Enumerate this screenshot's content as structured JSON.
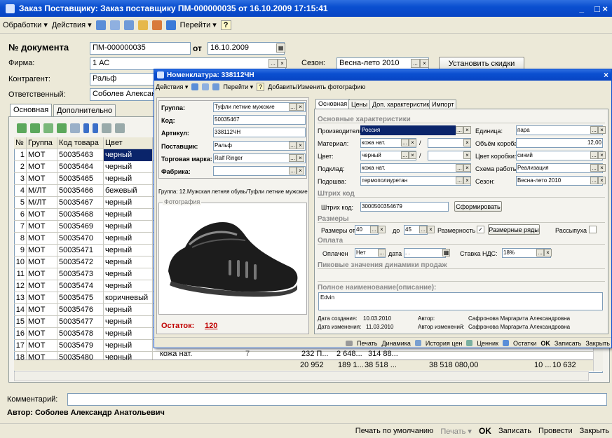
{
  "window": {
    "title": "Заказ Поставщику: Заказ поставщику ПМ-000000035 от 16.10.2009 17:15:41",
    "min": "_",
    "close": "□ ×"
  },
  "toolbar": {
    "processing": "Обработки ▾",
    "actions": "Действия ▾",
    "goto": "Перейти ▾",
    "help": "?"
  },
  "header": {
    "doc_label": "№ документа",
    "doc_value": "ПМ-000000035",
    "from_label": "от",
    "date_value": "16.10.2009",
    "firm_label": "Фирма:",
    "firm_value": "1 АС",
    "season_label": "Сезон:",
    "season_value": "Весна-лето 2010",
    "set_discounts": "Установить скидки",
    "contractor_label": "Контрагент:",
    "contractor_value": "Ральф",
    "responsible_label": "Ответственный:",
    "responsible_value": "Соболев Александ"
  },
  "tabs": {
    "main": "Основная",
    "extra": "Дополнительно"
  },
  "grid": {
    "headers": [
      "№",
      "Группа",
      "Код товара",
      "Цвет"
    ],
    "rows": [
      [
        "1",
        "МОТ",
        "50035463",
        "черный"
      ],
      [
        "2",
        "МОТ",
        "50035464",
        "черный"
      ],
      [
        "3",
        "МОТ",
        "50035465",
        "черный"
      ],
      [
        "4",
        "М/ЛТ",
        "50035466",
        "бежевый"
      ],
      [
        "5",
        "М/ЛТ",
        "50035467",
        "черный"
      ],
      [
        "6",
        "МОТ",
        "50035468",
        "черный"
      ],
      [
        "7",
        "МОТ",
        "50035469",
        "черный"
      ],
      [
        "8",
        "МОТ",
        "50035470",
        "черный"
      ],
      [
        "9",
        "МОТ",
        "50035471",
        "черный"
      ],
      [
        "10",
        "МОТ",
        "50035472",
        "черный"
      ],
      [
        "11",
        "МОТ",
        "50035473",
        "черный"
      ],
      [
        "12",
        "МОТ",
        "50035474",
        "черный"
      ],
      [
        "13",
        "МОТ",
        "50035475",
        "коричневый"
      ],
      [
        "14",
        "МОТ",
        "50035476",
        "черный"
      ],
      [
        "15",
        "МОТ",
        "50035477",
        "черный"
      ],
      [
        "16",
        "МОТ",
        "50035478",
        "черный"
      ],
      [
        "17",
        "МОТ",
        "50035479",
        "черный"
      ],
      [
        "18",
        "МОТ",
        "50035480",
        "черный"
      ]
    ],
    "row18_partial": [
      "кожа нат.",
      "7",
      "232 П...",
      "2 648...",
      "314 88..."
    ],
    "totals": [
      "20 952",
      "189 1...",
      "38 518 ...",
      "38 518 080,00",
      "10 ...",
      "10 632"
    ]
  },
  "footer": {
    "comment_label": "Комментарий:",
    "author": "Автор: Соболев Александр Анатольевич",
    "print_default": "Печать по умолчанию",
    "print": "Печать ▾",
    "ok": "OK",
    "save": "Записать",
    "post": "Провести",
    "close": "Закрыть"
  },
  "dialog": {
    "title": "Номенклатура: 338112ЧН",
    "toolbar": {
      "actions": "Действия ▾",
      "goto": "Перейти ▾",
      "help": "?",
      "add_photo": "Добавить/Изменить фотографию"
    },
    "left": {
      "group_label": "Группа:",
      "group_value": "Туфли летние мужские",
      "code_label": "Код:",
      "code_value": "50035467",
      "art_label": "Артикул:",
      "art_value": "338112ЧН",
      "supplier_label": "Поставщик:",
      "supplier_value": "Ральф",
      "brand_label": "Торговая марка:",
      "brand_value": "Ralf Ringer",
      "factory_label": "Фабрика:",
      "factory_value": "",
      "group_path": "Группа: 12.Мужская летняя обувь/Туфли летние мужские",
      "photo_label": "Фотография",
      "stock_label": "Остаток:",
      "stock_value": "120"
    },
    "tabs": [
      "Основная",
      "Цены",
      "Доп. характеристики",
      "Импорт"
    ],
    "main": {
      "sect_chars": "Основные характеристики",
      "maker_label": "Производитель:",
      "maker_value": "Россия",
      "unit_label": "Единица:",
      "unit_value": "пара",
      "material_label": "Материал:",
      "material_value": "кожа нат.",
      "boxvol_label": "Объём короба:",
      "boxvol_value": "12,00",
      "color_label": "Цвет:",
      "color_value": "черный",
      "boxcolor_label": "Цвет коробки:",
      "boxcolor_value": "синий",
      "lining_label": "Подклад:",
      "lining_value": "кожа нат.",
      "scheme_label": "Схема работы:",
      "scheme_value": "Реализация",
      "sole_label": "Подошва:",
      "sole_value": "термополиуретан",
      "season_label": "Сезон:",
      "season_value": "Весна-лето 2010",
      "sect_barcode": "Штрих код",
      "barcode_label": "Штрих код:",
      "barcode_value": "3000500354679",
      "form_btn": "Сформировать",
      "sect_sizes": "Размеры",
      "sizes_from_label": "Размеры от",
      "sizes_from": "40",
      "sizes_to_label": "до",
      "sizes_to": "45",
      "sizegrid_label": "Размерность",
      "size_rows_btn": "Размерные ряды",
      "loose_label": "Рассыпуха",
      "sect_payment": "Оплата",
      "paid_label": "Оплачен",
      "paid_value": "Нет",
      "date_label": "дата",
      "date_value": ". .",
      "vat_label": "Ставка НДС:",
      "vat_value": "18%",
      "sect_peak": "Пиковые значения динамики продаж",
      "sect_fullname": "Полное наименование(описание):",
      "fullname_value": "Edvin",
      "created_label": "Дата создания:",
      "created_value": "10.03.2010",
      "author_label": "Автор:",
      "author_value": "Сафронова Маргарита Александровна",
      "changed_label": "Дата изменения:",
      "changed_value": "11.03.2010",
      "author_changed_label": "Автор изменений:",
      "author_changed_value": "Сафронова Маргарита Александровна"
    },
    "bottom": {
      "print": "Печать",
      "dynamics": "Динамика",
      "price_history": "История цен",
      "price_tag": "Ценник",
      "stock": "Остатки",
      "ok": "OK",
      "save": "Записать",
      "close": "Закрыть"
    }
  }
}
